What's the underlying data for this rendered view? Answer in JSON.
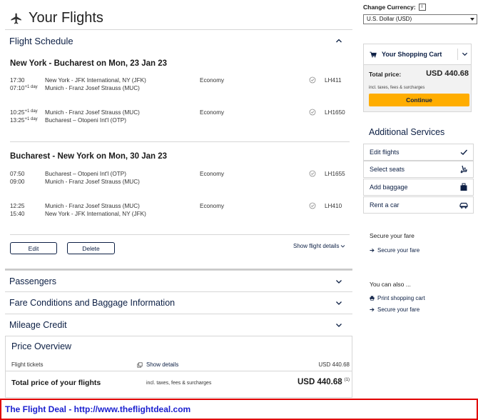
{
  "page": {
    "title": "Your Flights"
  },
  "schedule": {
    "section_title": "Flight Schedule",
    "outbound": {
      "route": "New York - Bucharest on Mon, 23 Jan 23",
      "segments": [
        {
          "dep_time": "17:30",
          "dep_sup": "",
          "arr_time": "07:10",
          "arr_sup": "+1 day",
          "dep_airport": "New York - JFK International, NY (JFK)",
          "arr_airport": "Munich - Franz Josef Strauss (MUC)",
          "cabin": "Economy",
          "flight": "LH411"
        },
        {
          "dep_time": "10:25",
          "dep_sup": "+1 day",
          "arr_time": "13:25",
          "arr_sup": "+1 day",
          "dep_airport": "Munich - Franz Josef Strauss (MUC)",
          "arr_airport": "Bucharest – Otopeni Int'l (OTP)",
          "cabin": "Economy",
          "flight": "LH1650"
        }
      ]
    },
    "inbound": {
      "route": "Bucharest - New York on Mon, 30 Jan 23",
      "segments": [
        {
          "dep_time": "07:50",
          "dep_sup": "",
          "arr_time": "09:00",
          "arr_sup": "",
          "dep_airport": "Bucharest – Otopeni Int'l (OTP)",
          "arr_airport": "Munich - Franz Josef Strauss (MUC)",
          "cabin": "Economy",
          "flight": "LH1655"
        },
        {
          "dep_time": "12:25",
          "dep_sup": "",
          "arr_time": "15:40",
          "arr_sup": "",
          "dep_airport": "Munich - Franz Josef Strauss (MUC)",
          "arr_airport": "New York - JFK International, NY (JFK)",
          "cabin": "Economy",
          "flight": "LH410"
        }
      ]
    },
    "edit_label": "Edit",
    "delete_label": "Delete",
    "show_details_label": "Show flight details"
  },
  "sections": {
    "passengers": "Passengers",
    "fare_conditions": "Fare Conditions and Baggage Information",
    "mileage": "Mileage Credit"
  },
  "price_overview": {
    "title": "Price Overview",
    "tickets_label": "Flight tickets",
    "show_details": "Show details",
    "tickets_value": "USD 440.68",
    "total_label": "Total price of your flights",
    "total_note": "incl. taxes, fees & surcharges",
    "total_value": "USD 440.68",
    "total_sup": "(1)"
  },
  "footer": {
    "text": "The Flight Deal - http://www.theflightdeal.com"
  },
  "currency": {
    "label": "Change Currency:",
    "info": "i",
    "selected": "U.S. Dollar (USD)"
  },
  "cart": {
    "title": "Your Shopping Cart",
    "total_label": "Total price:",
    "total_value": "USD 440.68",
    "note": "incl. taxes, fees & surcharges",
    "continue_label": "Continue"
  },
  "services": {
    "title": "Additional Services",
    "items": [
      {
        "label": "Edit flights",
        "icon": "check-icon"
      },
      {
        "label": "Select seats",
        "icon": "seat-icon"
      },
      {
        "label": "Add baggage",
        "icon": "baggage-icon"
      },
      {
        "label": "Rent a car",
        "icon": "car-icon"
      }
    ]
  },
  "secure": {
    "heading": "Secure your fare",
    "link": "Secure your fare"
  },
  "also": {
    "heading": "You can also ...",
    "print_link": "Print shopping cart",
    "secure_link": "Secure your fare"
  },
  "colors": {
    "brand_navy": "#0c1f44",
    "accent_yellow": "#ffad00",
    "footer_red": "#e00000",
    "footer_link": "#1a1fd0"
  }
}
